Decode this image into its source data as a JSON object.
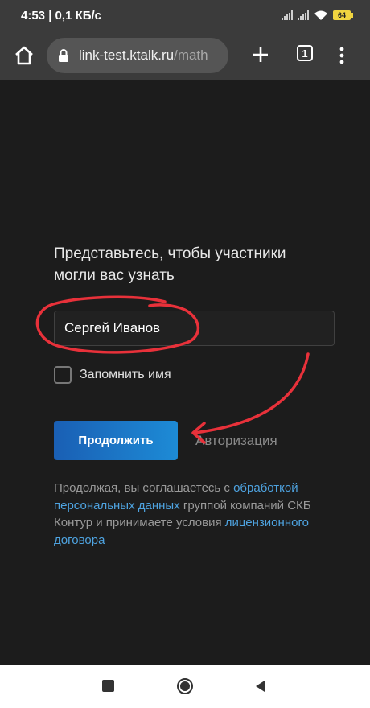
{
  "status_bar": {
    "time_speed": "4:53 | 0,1 КБ/с",
    "battery": "64"
  },
  "browser": {
    "url_domain": "link-test.ktalk.ru",
    "url_path": "/math",
    "tab_count": "1"
  },
  "form": {
    "heading": "Представьтесь, чтобы участники могли вас узнать",
    "name_value": "Сергей Иванов",
    "remember_label": "Запомнить имя",
    "remember_checked": false,
    "continue_label": "Продолжить",
    "auth_label": "Авторизация"
  },
  "legal": {
    "text1": "Продолжая, вы соглашаетесь с ",
    "link1": "обработкой персональных данных",
    "text2": " группой компаний СКБ Контур и принимаете условия ",
    "link2": "лицензионного договора"
  },
  "colors": {
    "annotation": "#e8313a",
    "accent": "#1d8bd6",
    "link": "#4ea3e0"
  }
}
